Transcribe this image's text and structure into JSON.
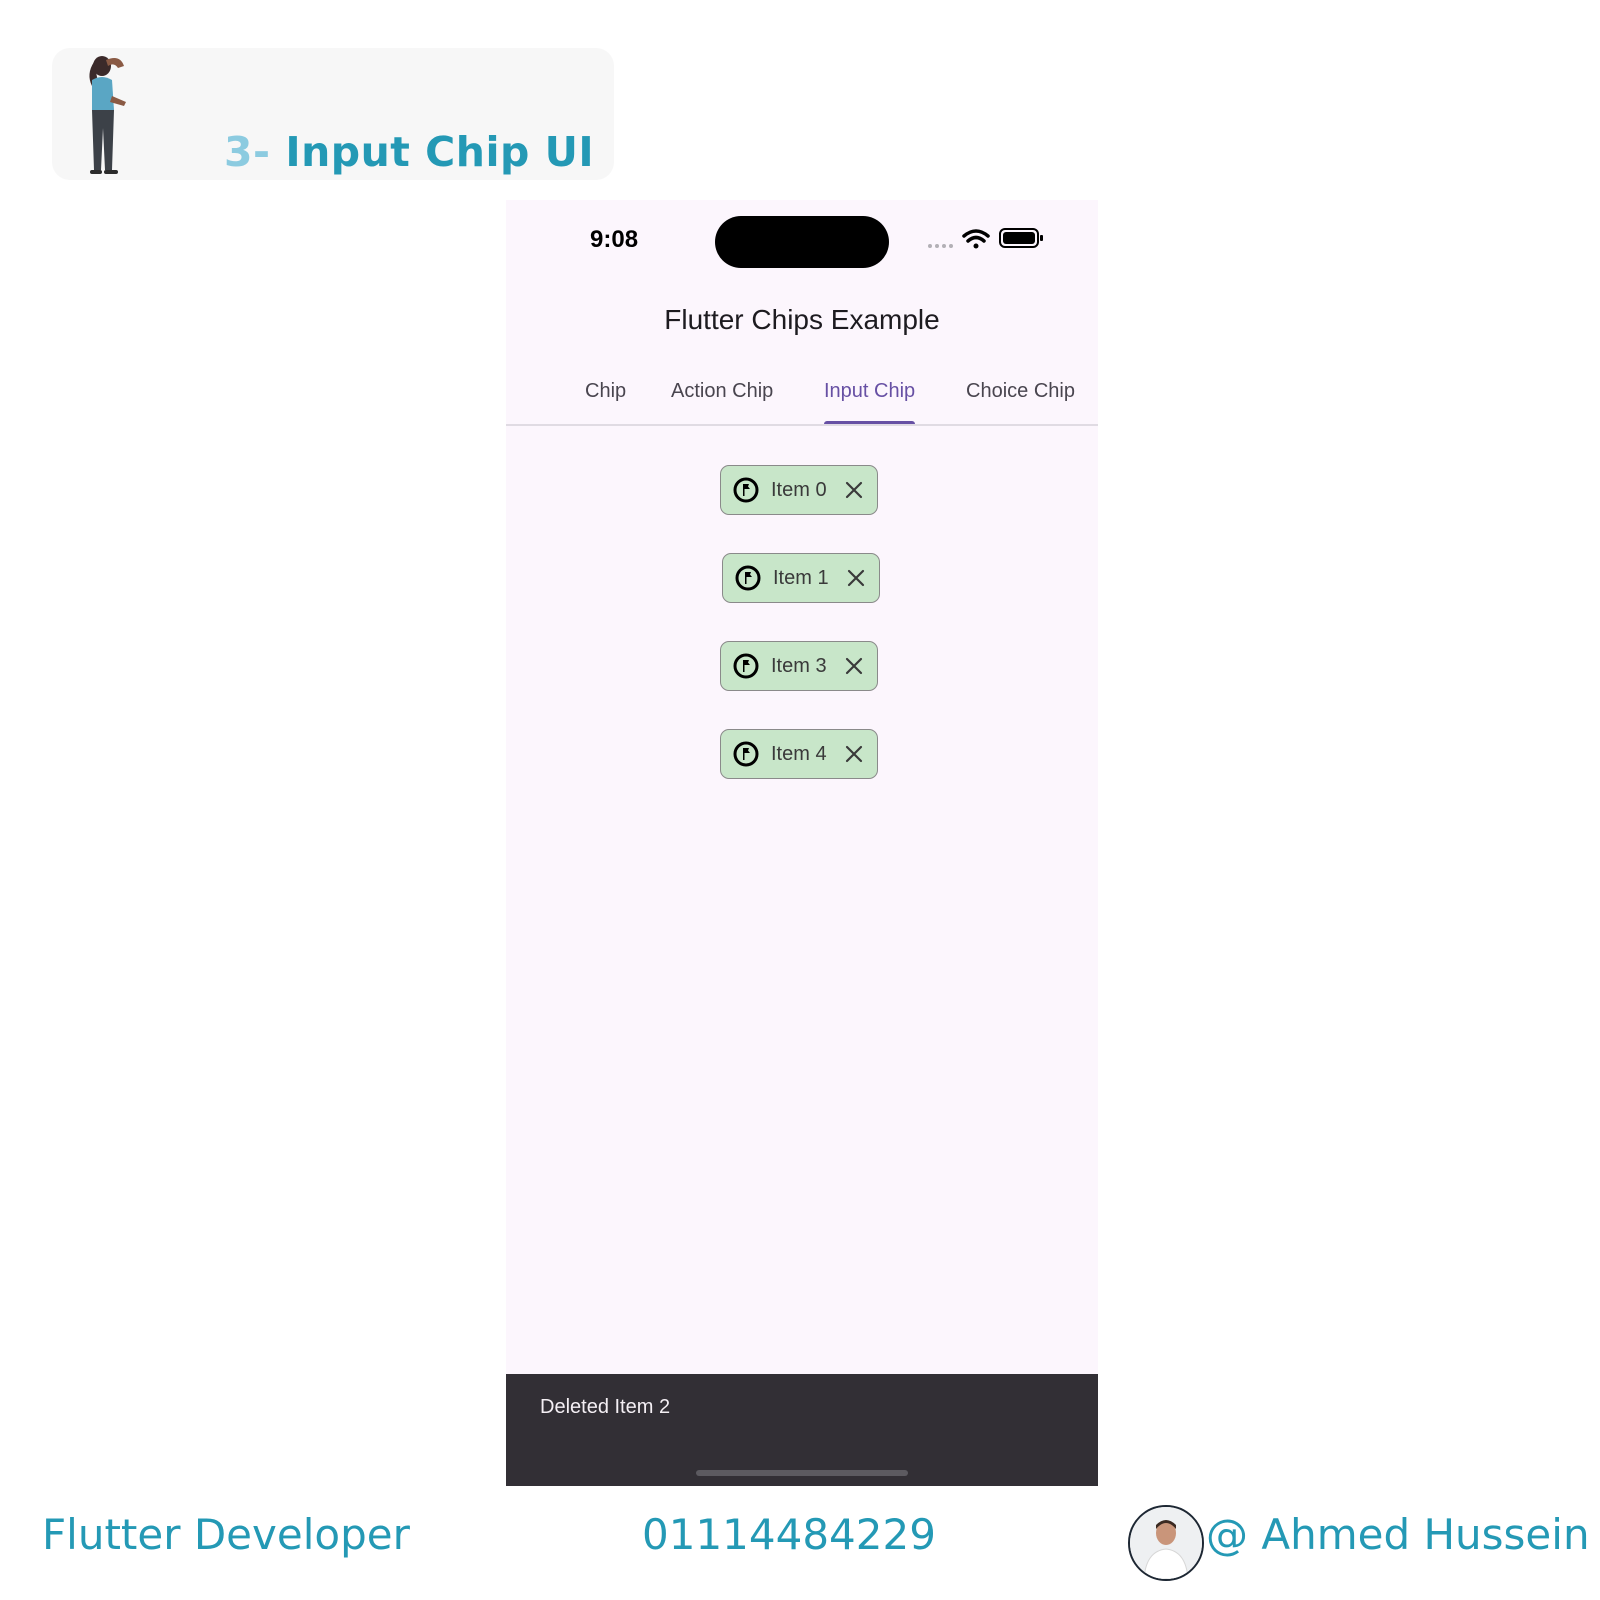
{
  "banner": {
    "number": "3-",
    "title": "Input Chip UI"
  },
  "status_bar": {
    "time": "9:08"
  },
  "app_bar": {
    "title": "Flutter Chips Example"
  },
  "tabs": [
    {
      "label": "Chip",
      "active": false
    },
    {
      "label": "Action Chip",
      "active": false
    },
    {
      "label": "Input Chip",
      "active": true
    },
    {
      "label": "Choice Chip",
      "active": false
    }
  ],
  "chips": [
    {
      "label": "Item 0",
      "icon": "flag-circle-icon"
    },
    {
      "label": "Item 1",
      "icon": "flag-circle-icon"
    },
    {
      "label": "Item 3",
      "icon": "flag-circle-icon"
    },
    {
      "label": "Item 4",
      "icon": "flag-circle-icon"
    }
  ],
  "snackbar": {
    "message": "Deleted Item 2"
  },
  "footer": {
    "role": "Flutter Developer",
    "phone": "01114484229",
    "author": "@ Ahmed Hussein"
  },
  "colors": {
    "accent": "#2499b5",
    "tab_active": "#6750a4",
    "chip_background": "#c8e6c9",
    "snackbar_background": "#322f35",
    "screen_background": "#fcf6fd"
  }
}
